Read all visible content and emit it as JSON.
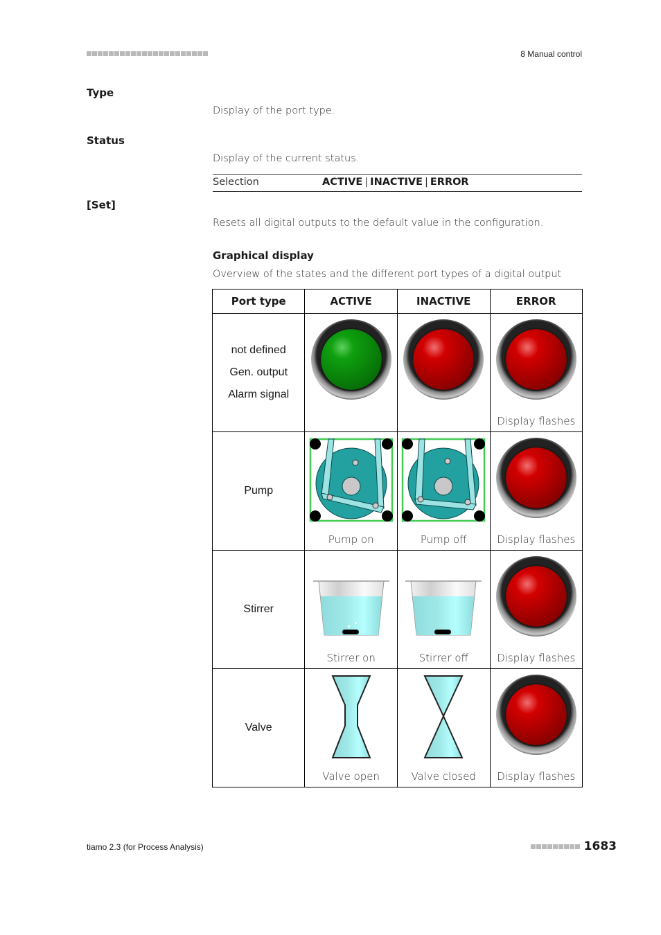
{
  "header": {
    "chapter": "8 Manual control"
  },
  "definitions": [
    {
      "term": "Type",
      "description": "Display of the port type."
    },
    {
      "term": "Status",
      "description": "Display of the current status."
    },
    {
      "term": "[Set]",
      "description": "Resets all digital outputs to the default value in the configuration."
    }
  ],
  "selection": {
    "label": "Selection",
    "options": [
      "ACTIVE",
      "INACTIVE",
      "ERROR"
    ],
    "separator": "|"
  },
  "graphical_display": {
    "heading": "Graphical display",
    "intro": "Overview of the states and the different port types of a digital output",
    "columns": [
      "Port type",
      "ACTIVE",
      "INACTIVE",
      "ERROR"
    ],
    "rows": [
      {
        "port_types": [
          "not defined",
          "Gen. output",
          "Alarm signal"
        ],
        "active": {
          "icon": "green-led-icon",
          "caption": ""
        },
        "inactive": {
          "icon": "red-led-icon",
          "caption": ""
        },
        "error": {
          "icon": "red-led-icon",
          "caption": "Display flashes"
        }
      },
      {
        "port_types": [
          "Pump"
        ],
        "active": {
          "icon": "pump-icon",
          "caption": "Pump on"
        },
        "inactive": {
          "icon": "pump-icon",
          "caption": "Pump off"
        },
        "error": {
          "icon": "red-led-icon",
          "caption": "Display flashes"
        }
      },
      {
        "port_types": [
          "Stirrer"
        ],
        "active": {
          "icon": "beaker-icon",
          "caption": "Stirrer on"
        },
        "inactive": {
          "icon": "beaker-icon",
          "caption": "Stirrer off"
        },
        "error": {
          "icon": "red-led-icon",
          "caption": "Display flashes"
        }
      },
      {
        "port_types": [
          "Valve"
        ],
        "active": {
          "icon": "valve-open-icon",
          "caption": "Valve open"
        },
        "inactive": {
          "icon": "valve-closed-icon",
          "caption": "Valve closed"
        },
        "error": {
          "icon": "red-led-icon",
          "caption": "Display flashes"
        }
      }
    ]
  },
  "footer": {
    "product": "tiamo 2.3 (for Process Analysis)",
    "page_number": "1683"
  },
  "colors": {
    "led_green": "#0a9a0a",
    "led_red": "#c80000",
    "pump_teal": "#23a0a0",
    "liquid": "#a8f0f0",
    "pump_frame": "#44cc55"
  }
}
